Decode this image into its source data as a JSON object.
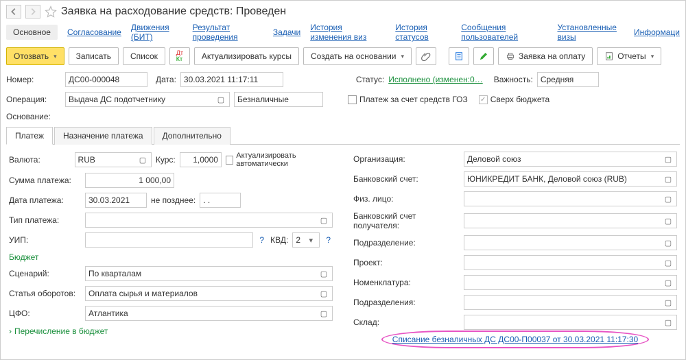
{
  "header": {
    "title": "Заявка на расходование средств: Проведен"
  },
  "linkTabs": {
    "main": "Основное",
    "items": [
      "Согласование",
      "Движения (БИТ)",
      "Результат проведения",
      "Задачи",
      "История изменения виз",
      "История статусов",
      "Сообщения пользователей",
      "Установленные визы",
      "Информаци"
    ]
  },
  "toolbar": {
    "recall": "Отозвать",
    "write": "Записать",
    "list": "Список",
    "updateRates": "Актуализировать курсы",
    "createBased": "Создать на основании",
    "payRequest": "Заявка на оплату",
    "reports": "Отчеты"
  },
  "fields": {
    "numberLabel": "Номер:",
    "number": "ДС00-000048",
    "dateLabel": "Дата:",
    "date": "30.03.2021 11:17:11",
    "statusLabel": "Статус:",
    "status": "Исполнено (изменен:0…",
    "priorityLabel": "Важность:",
    "priority": "Средняя",
    "operationLabel": "Операция:",
    "operation": "Выдача ДС подотчетнику",
    "operationType": "Безналичные",
    "gozLabel": "Платеж за счет средств ГОЗ",
    "overBudgetLabel": "Сверх бюджета",
    "basisLabel": "Основание:"
  },
  "tabs": {
    "payment": "Платеж",
    "purpose": "Назначение платежа",
    "extra": "Дополнительно"
  },
  "left": {
    "currencyLabel": "Валюта:",
    "currency": "RUB",
    "rateLabel": "Курс:",
    "rate": "1,0000",
    "autoUpdate": "Актуализировать автоматически",
    "sumLabel": "Сумма платежа:",
    "sum": "1 000,00",
    "payDateLabel": "Дата платежа:",
    "payDate": "30.03.2021",
    "notLaterLabel": "не позднее:",
    "notLater": "  .  .",
    "payTypeLabel": "Тип платежа:",
    "payType": "",
    "uipLabel": "УИП:",
    "uip": "",
    "kvdLabel": "КВД:",
    "kvd": "2",
    "budgetHeader": "Бюджет",
    "scenarioLabel": "Сценарий:",
    "scenario": "По кварталам",
    "turnoverLabel": "Статья оборотов:",
    "turnover": "Оплата сырья и материалов",
    "cfoLabel": "ЦФО:",
    "cfo": "Атлантика",
    "expandLink": "Перечисление в бюджет"
  },
  "right": {
    "orgLabel": "Организация:",
    "org": "Деловой союз",
    "bankLabel": "Банковский счет:",
    "bank": "ЮНИКРЕДИТ БАНК, Деловой союз (RUB)",
    "personLabel": "Физ. лицо:",
    "person": "",
    "recvBankLabel": "Банковский счет получателя:",
    "recvBank": "",
    "divisionLabel": "Подразделение:",
    "division": "",
    "projectLabel": "Проект:",
    "project": "",
    "nomenLabel": "Номенклатура:",
    "nomen": "",
    "divisionsLabel": "Подразделения:",
    "divisions": "",
    "stockLabel": "Склад:",
    "stock": "",
    "bottomLink": "Списание безналичных ДС ДС00-П00037 от 30.03.2021 11:17:30"
  }
}
